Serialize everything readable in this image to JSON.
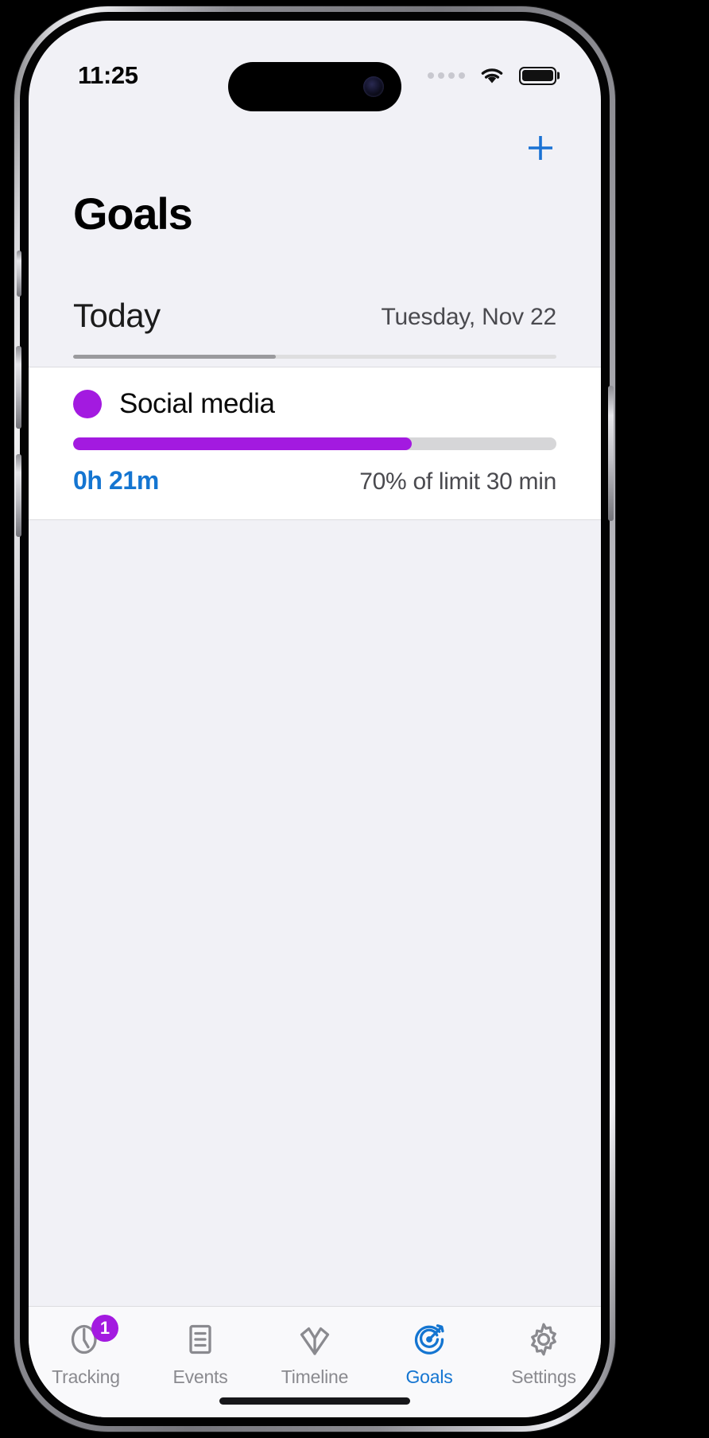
{
  "status_bar": {
    "time": "11:25",
    "signal_icon": "cellular-dots-icon",
    "wifi_icon": "wifi-icon",
    "battery_icon": "battery-full-icon"
  },
  "nav": {
    "add_button_icon": "plus-icon",
    "add_button_label": "+",
    "accent_color": "#1475d1"
  },
  "header": {
    "title": "Goals"
  },
  "period": {
    "label": "Today",
    "date": "Tuesday, Nov 22",
    "underline_progress_percent": 42
  },
  "goals": [
    {
      "name": "Social media",
      "color": "#a31ae0",
      "elapsed": "0h 21m",
      "limit_text": "70% of limit 30 min",
      "progress_percent": 70
    }
  ],
  "tab_bar": {
    "items": [
      {
        "label": "Tracking",
        "icon": "clock-icon",
        "active": false,
        "badge": "1"
      },
      {
        "label": "Events",
        "icon": "document-icon",
        "active": false,
        "badge": ""
      },
      {
        "label": "Timeline",
        "icon": "timeline-icon",
        "active": false,
        "badge": ""
      },
      {
        "label": "Goals",
        "icon": "target-icon",
        "active": true,
        "badge": ""
      },
      {
        "label": "Settings",
        "icon": "gear-icon",
        "active": false,
        "badge": ""
      }
    ],
    "active_color": "#1475d1",
    "inactive_color": "#8a8a8f",
    "badge_color": "#a31ae0"
  }
}
